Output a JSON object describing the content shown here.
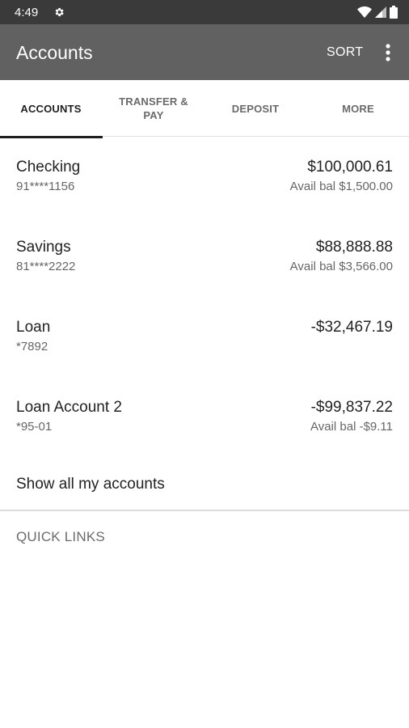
{
  "status_bar": {
    "time": "4:49",
    "icons": [
      "gear-icon",
      "wifi-icon",
      "signal-icon",
      "battery-icon"
    ]
  },
  "app_bar": {
    "title": "Accounts",
    "sort_label": "SORT",
    "overflow_icon": "more-vert-icon"
  },
  "tabs": [
    {
      "label": "ACCOUNTS",
      "active": true
    },
    {
      "label": "TRANSFER & PAY",
      "active": false
    },
    {
      "label": "DEPOSIT",
      "active": false
    },
    {
      "label": "MORE",
      "active": false
    }
  ],
  "accounts": [
    {
      "name": "Checking",
      "number": "91****1156",
      "balance": "$100,000.61",
      "avail": "Avail bal $1,500.00"
    },
    {
      "name": "Savings",
      "number": "81****2222",
      "balance": "$88,888.88",
      "avail": "Avail bal $3,566.00"
    },
    {
      "name": "Loan",
      "number": "*7892",
      "balance": "-$32,467.19",
      "avail": ""
    },
    {
      "name": "Loan Account 2",
      "number": "*95-01",
      "balance": "-$99,837.22",
      "avail": "Avail bal -$9.11"
    }
  ],
  "show_all_label": "Show all my accounts",
  "quick_links_label": "QUICK LINKS",
  "colors": {
    "status_bar": "#3a3a3a",
    "app_bar": "#616161",
    "tab_indicator": "#1f1f1f"
  }
}
